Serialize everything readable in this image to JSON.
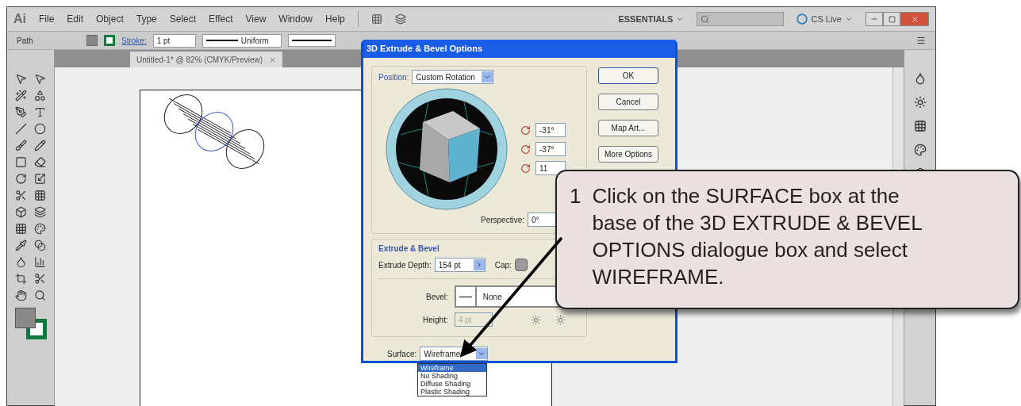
{
  "app_logo": "Ai",
  "menu": [
    "File",
    "Edit",
    "Object",
    "Type",
    "Select",
    "Effect",
    "View",
    "Window",
    "Help"
  ],
  "workspace": "ESSENTIALS",
  "cs_live": "CS Live",
  "control_bar": {
    "selection": "Path",
    "stroke_label": "Stroke:",
    "stroke_weight": "1 pt",
    "profile": "Uniform"
  },
  "document_tab": {
    "title": "Untitled-1* @ 82% (CMYK/Preview)",
    "selected": true
  },
  "dialog": {
    "title": "3D Extrude & Bevel Options",
    "position_label": "Position:",
    "position_value": "Custom Rotation",
    "rotations": [
      "-31°",
      "-37°",
      "11"
    ],
    "perspective_label": "Perspective:",
    "perspective_value": "0°",
    "buttons": [
      "OK",
      "Cancel",
      "Map Art...",
      "More Options"
    ],
    "extrude_group": "Extrude & Bevel",
    "depth_label": "Extrude Depth:",
    "depth_value": "154 pt",
    "cap_label": "Cap:",
    "bevel_label": "Bevel:",
    "bevel_value": "None",
    "height_label": "Height:",
    "height_value": "4 pt",
    "height_disabled": true,
    "surface_label": "Surface:",
    "surface_value": "Wireframe",
    "surface_options": [
      {
        "label": "Wireframe",
        "selected": true
      },
      {
        "label": "No Shading",
        "selected": false
      },
      {
        "label": "Diffuse Shading",
        "selected": false
      },
      {
        "label": "Plastic Shading",
        "selected": false
      }
    ]
  },
  "callout": {
    "number": "1",
    "lines": [
      "Click on the SURFACE box at the",
      "base of the 3D EXTRUDE & BEVEL",
      "OPTIONS dialogue box and select",
      "WIREFRAME."
    ]
  }
}
